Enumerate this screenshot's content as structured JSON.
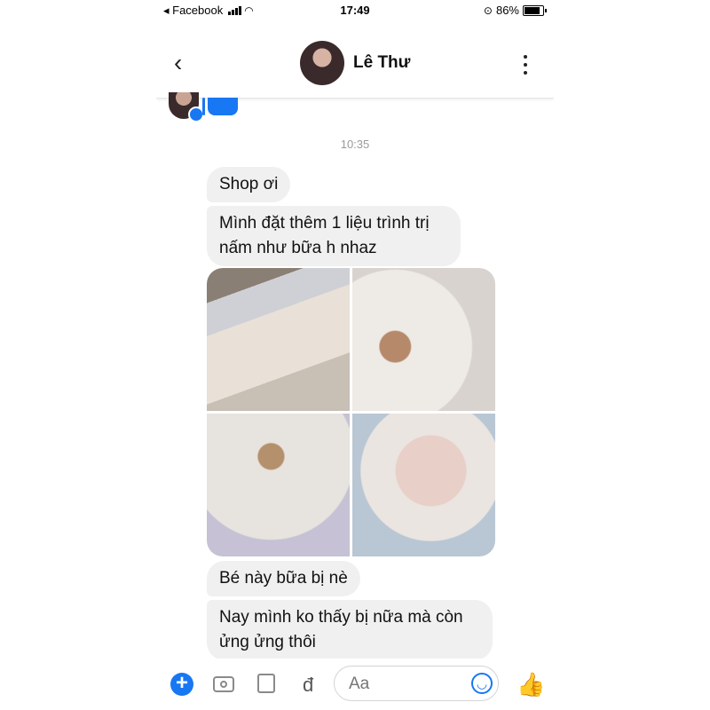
{
  "status_bar": {
    "carrier": "◂ Facebook",
    "time": "17:49",
    "battery": "86%"
  },
  "header": {
    "contact_name": "Lê Thư",
    "back_icon": "chevron-left-icon",
    "more_icon": "vertical-dots-icon"
  },
  "chat": {
    "timestamp": "10:35",
    "messages": [
      {
        "text": "Shop ơi"
      },
      {
        "text": "Mình đặt thêm 1 liệu trình trị nấm như bữa h nhaz"
      },
      {
        "text": "Bé này bữa bị nè"
      },
      {
        "text": "Nay mình ko thấy bị nữa mà còn ửng ửng thôi"
      }
    ]
  },
  "composer": {
    "placeholder": "Aa",
    "currency_symbol": "đ",
    "plus_icon": "plus-icon",
    "camera_icon": "camera-icon",
    "gallery_icon": "gallery-icon",
    "emoji_icon": "emoji-icon",
    "like_icon": "thumbs-up-icon",
    "accent_color": "#1877f2"
  }
}
